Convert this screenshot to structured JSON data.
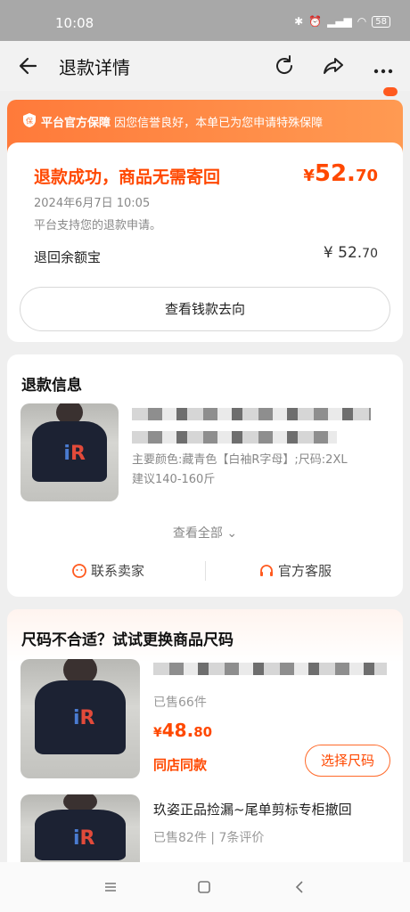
{
  "statusbar": {
    "time": "10:08",
    "battery": "58"
  },
  "nav": {
    "title": "退款详情"
  },
  "banner": {
    "badge": "平台官方保障",
    "text": "因您信誉良好，本单已为您申请特殊保障"
  },
  "refund": {
    "status": "退款成功，商品无需寄回",
    "amount_symbol": "¥",
    "amount_int": "52.",
    "amount_dec": "70",
    "date": "2024年6月7日 10:05",
    "note": "平台支持您的退款申请。",
    "dest_label": "退回余额宝",
    "dest_amount_int": "¥ 52.",
    "dest_amount_dec": "70",
    "track_button": "查看钱款去向"
  },
  "refund_info": {
    "heading": "退款信息",
    "spec": "主要颜色:藏青色【白袖R字母】;尺码:2XL 建议140-160斤",
    "view_all": "查看全部",
    "contact_seller": "联系卖家",
    "official_service": "官方客服"
  },
  "size_suggest": {
    "heading": "尺码不合适？试试更换商品尺码",
    "item1": {
      "sold": "已售66件",
      "price_symbol": "¥",
      "price_int": "48.",
      "price_dec": "80",
      "same_shop": "同店同款",
      "choose_size": "选择尺码"
    },
    "item2": {
      "name": "玖姿正品捡漏~尾单剪标专柜撤回",
      "sold": "已售82件",
      "reviews": "7条评价"
    }
  }
}
